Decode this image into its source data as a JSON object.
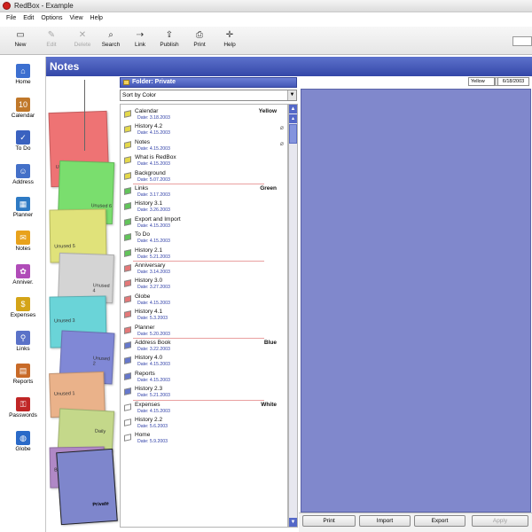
{
  "window": {
    "title": "RedBox - Example"
  },
  "menu": [
    "File",
    "Edit",
    "Options",
    "View",
    "Help"
  ],
  "toolbar": [
    {
      "label": "New",
      "icon": "new-icon",
      "glyph": "▭",
      "enabled": true
    },
    {
      "label": "Edit",
      "icon": "edit-icon",
      "glyph": "✎",
      "enabled": false
    },
    {
      "label": "Delete",
      "icon": "delete-icon",
      "glyph": "✕",
      "enabled": false
    },
    {
      "label": "Search",
      "icon": "search-icon",
      "glyph": "⌕",
      "enabled": true
    },
    {
      "label": "Link",
      "icon": "link-icon",
      "glyph": "⇢",
      "enabled": true
    },
    {
      "label": "Publish",
      "icon": "publish-icon",
      "glyph": "⇪",
      "enabled": true
    },
    {
      "label": "Print",
      "icon": "print-icon",
      "glyph": "⎙",
      "enabled": true
    },
    {
      "label": "Help",
      "icon": "help-icon",
      "glyph": "✛",
      "enabled": true
    }
  ],
  "nav": [
    {
      "label": "Home",
      "icon": "home-icon",
      "glyph": "⌂",
      "color": "#3c6fd0"
    },
    {
      "label": "Calendar",
      "icon": "calendar-icon",
      "glyph": "10",
      "color": "#c0782a"
    },
    {
      "label": "To Do",
      "icon": "todo-icon",
      "glyph": "✓",
      "color": "#3a62c0"
    },
    {
      "label": "Address",
      "icon": "address-icon",
      "glyph": "☺",
      "color": "#4470c8"
    },
    {
      "label": "Planner",
      "icon": "planner-icon",
      "glyph": "▦",
      "color": "#2e7ac4"
    },
    {
      "label": "Notes",
      "icon": "notes-icon",
      "glyph": "✉",
      "color": "#e8a21c"
    },
    {
      "label": "Anniver.",
      "icon": "gift-icon",
      "glyph": "✿",
      "color": "#b04cb8"
    },
    {
      "label": "Expenses",
      "icon": "coins-icon",
      "glyph": "$",
      "color": "#d4a418"
    },
    {
      "label": "Links",
      "icon": "links-icon",
      "glyph": "⚲",
      "color": "#5a72c8"
    },
    {
      "label": "Reports",
      "icon": "reports-icon",
      "glyph": "▤",
      "color": "#c86a28"
    },
    {
      "label": "Passwords",
      "icon": "key-icon",
      "glyph": "⚿",
      "color": "#c02626"
    },
    {
      "label": "Globe",
      "icon": "globe-icon",
      "glyph": "◍",
      "color": "#2a6ac8"
    }
  ],
  "header": {
    "title": "Notes"
  },
  "sticky_notes": [
    {
      "label": "Unused 7",
      "color": "#ee7374"
    },
    {
      "label": "Unused 6",
      "color": "#7ade6e"
    },
    {
      "label": "Unused 5",
      "color": "#e0e27a"
    },
    {
      "label": "Unused 4",
      "color": "#d4d4d4"
    },
    {
      "label": "Unused 3",
      "color": "#6ad4d8"
    },
    {
      "label": "Unused 2",
      "color": "#8088d6"
    },
    {
      "label": "Unused 1",
      "color": "#eab28a"
    },
    {
      "label": "Daily",
      "color": "#c4d88a"
    },
    {
      "label": "Business",
      "color": "#b088c6"
    },
    {
      "label": "Private",
      "color": "#7e86cc"
    }
  ],
  "folder": {
    "title": "Folder: Private"
  },
  "sort": {
    "value": "Sort by Color"
  },
  "groups": [
    {
      "name": "Yellow",
      "color": "#e4d84a",
      "items": [
        {
          "title": "Calendar",
          "date": "Date: 3.18.2003",
          "clip": false
        },
        {
          "title": "History 4.2",
          "date": "Date: 4.15.2003",
          "clip": true
        },
        {
          "title": "Notes",
          "date": "Date: 4.15.2003",
          "clip": true
        },
        {
          "title": "What is RedBox",
          "date": "Date: 4.15.2003",
          "clip": false
        },
        {
          "title": "Background",
          "date": "Date: 5.07.2003",
          "clip": false
        }
      ]
    },
    {
      "name": "Green",
      "color": "#62c45a",
      "items": [
        {
          "title": "Links",
          "date": "Date: 3.17.2003",
          "clip": false
        },
        {
          "title": "History 3.1",
          "date": "Date: 3.26.2003",
          "clip": false
        },
        {
          "title": "Export and Import",
          "date": "Date: 4.15.2003",
          "clip": false
        },
        {
          "title": "To Do",
          "date": "Date: 4.15.2003",
          "clip": false
        },
        {
          "title": "History 2.1",
          "date": "Date: 5.21.2003",
          "clip": false
        }
      ]
    },
    {
      "name": "",
      "color": "#e47878",
      "items": [
        {
          "title": "Anniversary",
          "date": "Date: 3.14.2003",
          "clip": false
        },
        {
          "title": "History 3.0",
          "date": "Date: 3.27.2003",
          "clip": false
        },
        {
          "title": "Globe",
          "date": "Date: 4.15.2003",
          "clip": false
        },
        {
          "title": "History 4.1",
          "date": "Date: 5.3.2003",
          "clip": false
        },
        {
          "title": "Planner",
          "date": "Date: 5.20.2003",
          "clip": false
        }
      ]
    },
    {
      "name": "Blue",
      "color": "#6678cc",
      "items": [
        {
          "title": "Address Book",
          "date": "Date: 3.22.2003",
          "clip": false
        },
        {
          "title": "History 4.0",
          "date": "Date: 4.15.2003",
          "clip": false
        },
        {
          "title": "Reports",
          "date": "Date: 4.15.2003",
          "clip": false
        },
        {
          "title": "History 2.3",
          "date": "Date: 5.21.2003",
          "clip": false
        }
      ]
    },
    {
      "name": "White",
      "color": "#ffffff",
      "items": [
        {
          "title": "Expenses",
          "date": "Date: 4.15.2003",
          "clip": false
        },
        {
          "title": "History 2.2",
          "date": "Date: 5.6.2003",
          "clip": false
        },
        {
          "title": "Home",
          "date": "Date: 5.9.2003",
          "clip": false
        }
      ]
    }
  ],
  "editor": {
    "color_value": "Yellow",
    "date_value": "6/18/2003",
    "background": "#8088cc"
  },
  "buttons": [
    {
      "label": "Print",
      "enabled": true
    },
    {
      "label": "Import",
      "enabled": true
    },
    {
      "label": "Export",
      "enabled": true
    },
    {
      "label": "Apply",
      "enabled": false
    }
  ]
}
